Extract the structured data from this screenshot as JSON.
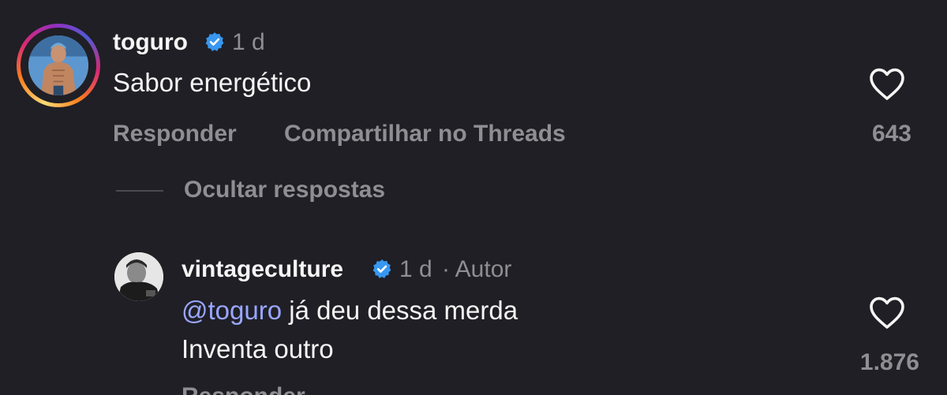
{
  "comment": {
    "username": "toguro",
    "time": "1 d",
    "text": "Sabor energético",
    "actions": {
      "reply": "Responder",
      "share": "Compartilhar no Threads"
    },
    "likes": "643",
    "hide_replies": "Ocultar respostas"
  },
  "reply": {
    "username": "vintageculture",
    "time": "1 d",
    "author_tag": "· Autor",
    "mention": "@toguro",
    "text_line1": " já deu dessa merda",
    "text_line2": "Inventa outro",
    "likes": "1.876",
    "reply_action_partial": "Responder"
  },
  "colors": {
    "background": "#1f1f25",
    "verified": "#3897f0",
    "mention": "#9aa6ff",
    "muted": "#8e8e93"
  },
  "icons": {
    "verified": "verified-badge-icon",
    "like": "heart-outline-icon"
  }
}
